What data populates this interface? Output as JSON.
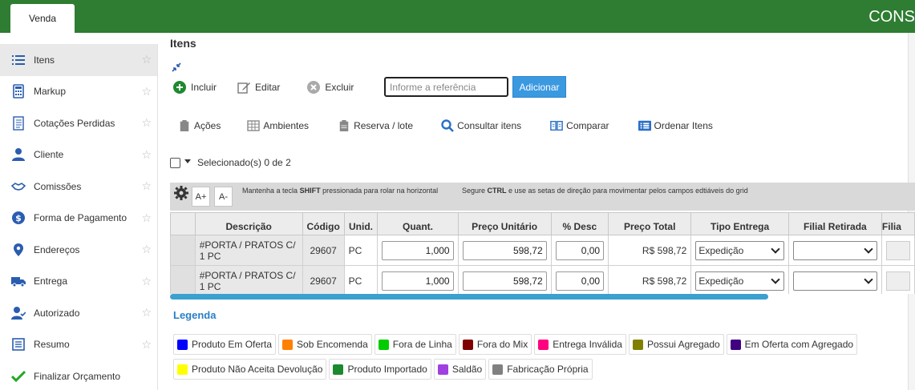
{
  "topbar": {
    "tab_label": "Venda",
    "brand_text": "CONS"
  },
  "sidebar": {
    "items": [
      {
        "label": "Itens",
        "active": true,
        "icon": "list-icon"
      },
      {
        "label": "Markup",
        "icon": "calculator-icon"
      },
      {
        "label": "Cotações Perdidas",
        "icon": "document-icon"
      },
      {
        "label": "Cliente",
        "icon": "user-icon"
      },
      {
        "label": "Comissões",
        "icon": "handshake-icon"
      },
      {
        "label": "Forma de Pagamento",
        "icon": "dollar-icon"
      },
      {
        "label": "Endereços",
        "icon": "map-pin-icon"
      },
      {
        "label": "Entrega",
        "icon": "truck-icon"
      },
      {
        "label": "Autorizado",
        "icon": "user-check-icon"
      },
      {
        "label": "Resumo",
        "icon": "summary-icon"
      },
      {
        "label": "Finalizar Orçamento",
        "icon": "check-icon"
      }
    ]
  },
  "main": {
    "title": "Itens",
    "toolbar": {
      "incluir": "Incluir",
      "editar": "Editar",
      "excluir": "Excluir",
      "ref_placeholder": "Informe a referência",
      "adicionar": "Adicionar"
    },
    "actions": {
      "acoes": "Ações",
      "ambientes": "Ambientes",
      "reserva": "Reserva / lote",
      "consultar": "Consultar itens",
      "comparar": "Comparar",
      "ordenar": "Ordenar Itens"
    },
    "selection_text": "Selecionado(s) 0 de 2",
    "grid_toolbar": {
      "font_increase": "A+",
      "font_decrease": "A-",
      "hint_shift_pre": "Mantenha a tecla ",
      "hint_shift_key": "SHIFT",
      "hint_shift_post": " pressionada para rolar na horizontal",
      "hint_ctrl_pre": "Segure ",
      "hint_ctrl_key": "CTRL",
      "hint_ctrl_post": " e use as setas de direção para movimentar pelos campos edtiáveis do grid"
    },
    "table": {
      "headers": [
        "Descrição",
        "Código",
        "Unid.",
        "Quant.",
        "Preço Unitário",
        "% Desc",
        "Preço Total",
        "Tipo Entrega",
        "Filial Retirada",
        "Filia"
      ],
      "rows": [
        {
          "descricao": "#PORTA / PRATOS C/ 1 PC",
          "codigo": "29607",
          "unid": "PC",
          "quant": "1,000",
          "preco_unit": "598,72",
          "desc": "0,00",
          "preco_total": "R$ 598,72",
          "tipo_entrega": "Expedição",
          "filial": ""
        },
        {
          "descricao": "#PORTA / PRATOS C/ 1 PC",
          "codigo": "29607",
          "unid": "PC",
          "quant": "1,000",
          "preco_unit": "598,72",
          "desc": "0,00",
          "preco_total": "R$ 598,72",
          "tipo_entrega": "Expedição",
          "filial": ""
        }
      ]
    },
    "legend": {
      "title": "Legenda",
      "items": [
        {
          "label": "Produto Em Oferta",
          "color": "#0000ff"
        },
        {
          "label": "Sob Encomenda",
          "color": "#ff8000"
        },
        {
          "label": "Fora de Linha",
          "color": "#00cc00"
        },
        {
          "label": "Fora do Mix",
          "color": "#800000"
        },
        {
          "label": "Entrega Inválida",
          "color": "#ff0080"
        },
        {
          "label": "Possui Agregado",
          "color": "#808000"
        },
        {
          "label": "Em Oferta com Agregado",
          "color": "#400080"
        },
        {
          "label": "Produto Não Aceita Devolução",
          "color": "#ffff00"
        },
        {
          "label": "Produto Importado",
          "color": "#1b8a2e"
        },
        {
          "label": "Saldão",
          "color": "#a040e0"
        },
        {
          "label": "Fabricação Própria",
          "color": "#808080"
        }
      ]
    }
  }
}
